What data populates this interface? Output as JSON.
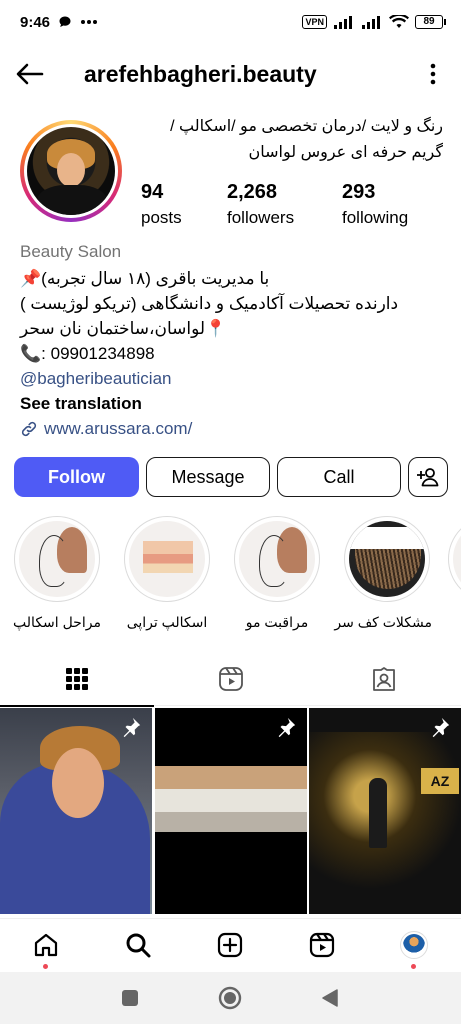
{
  "status_bar": {
    "time": "9:46",
    "vpn": "VPN",
    "battery": "89",
    "icons": [
      "chat-bubble-icon",
      "more-dots-icon",
      "signal-icon",
      "signal-icon",
      "wifi-icon"
    ]
  },
  "header": {
    "username": "arefehbagheri.beauty"
  },
  "profile": {
    "bio_head_line1": "رنگ و لایت /درمان تخصصی مو /اسکالپ /",
    "bio_head_line2": "گریم حرفه ای عروس لواسان",
    "stats": [
      {
        "value": "94",
        "label": "posts"
      },
      {
        "value": "2,268",
        "label": "followers"
      },
      {
        "value": "293",
        "label": "following"
      }
    ],
    "category": "Beauty Salon",
    "bio_lines": [
      "با مدیریت باقری (۱۸ سال تجربه)📌",
      "دارنده تحصیلات آکادمیک و دانشگاهی  (تریکو لوژیست )",
      "📍لواسان،ساختمان نان سحر",
      "📞: 09901234898"
    ],
    "mention": "@bagheribeautician",
    "see_translation": "See translation",
    "website": "www.arussara.com/"
  },
  "actions": {
    "follow": "Follow",
    "message": "Message",
    "call": "Call"
  },
  "highlights": [
    {
      "label": "مراحل اسکالپ"
    },
    {
      "label": "اسکالپ تراپی"
    },
    {
      "label": "مراقبت مو"
    },
    {
      "label": "مشکلات کف سر"
    }
  ],
  "tabs": [
    "grid-icon",
    "reels-icon",
    "tagged-icon"
  ],
  "posts": [
    {
      "pinned": true
    },
    {
      "pinned": true
    },
    {
      "pinned": true,
      "logo_text": "AZ"
    }
  ],
  "bottom_nav": [
    "home-icon",
    "search-icon",
    "create-icon",
    "reels-icon",
    "profile-avatar"
  ],
  "colors": {
    "accent": "#4f5bf5",
    "link": "#385185",
    "category": "#737373",
    "notification": "#ed4956"
  }
}
